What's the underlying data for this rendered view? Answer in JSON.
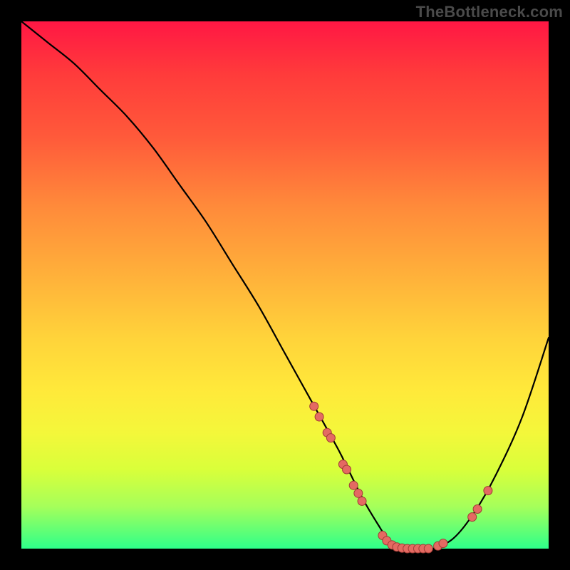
{
  "watermark": "TheBottleneck.com",
  "chart_data": {
    "type": "line",
    "title": "",
    "xlabel": "",
    "ylabel": "",
    "xlim": [
      0,
      100
    ],
    "ylim": [
      0,
      100
    ],
    "grid": false,
    "legend": false,
    "background_gradient": [
      "#ff1744",
      "#ff5a3a",
      "#ffb03a",
      "#ffe93a",
      "#d9ff3a",
      "#2eff8a"
    ],
    "series": [
      {
        "name": "bottleneck-curve",
        "color": "#000000",
        "x": [
          0,
          5,
          10,
          15,
          20,
          25,
          30,
          35,
          40,
          45,
          50,
          55,
          60,
          62,
          65,
          68,
          70,
          72,
          75,
          78,
          82,
          86,
          90,
          95,
          100
        ],
        "y": [
          100,
          96,
          92,
          87,
          82,
          76,
          69,
          62,
          54,
          46,
          37,
          28,
          19,
          15,
          9,
          4,
          1,
          0,
          0,
          0,
          2,
          7,
          14,
          25,
          40
        ]
      }
    ],
    "markers": [
      {
        "name": "cluster-left-upper",
        "x": 55.5,
        "y": 27
      },
      {
        "name": "cluster-left-upper",
        "x": 56.5,
        "y": 25
      },
      {
        "name": "cluster-left-upper",
        "x": 58.0,
        "y": 22
      },
      {
        "name": "cluster-left-upper",
        "x": 58.7,
        "y": 21
      },
      {
        "name": "cluster-left-mid",
        "x": 61.0,
        "y": 16
      },
      {
        "name": "cluster-left-mid",
        "x": 61.7,
        "y": 15
      },
      {
        "name": "cluster-left-mid",
        "x": 63.0,
        "y": 12
      },
      {
        "name": "cluster-left-mid",
        "x": 63.9,
        "y": 10.5
      },
      {
        "name": "cluster-left-mid",
        "x": 64.6,
        "y": 9
      },
      {
        "name": "cluster-bottom",
        "x": 68.5,
        "y": 2.5
      },
      {
        "name": "cluster-bottom",
        "x": 69.3,
        "y": 1.5
      },
      {
        "name": "cluster-bottom",
        "x": 70.3,
        "y": 0.7
      },
      {
        "name": "cluster-bottom",
        "x": 71.2,
        "y": 0.3
      },
      {
        "name": "cluster-bottom",
        "x": 72.2,
        "y": 0.1
      },
      {
        "name": "cluster-bottom",
        "x": 73.2,
        "y": 0
      },
      {
        "name": "cluster-bottom",
        "x": 74.2,
        "y": 0
      },
      {
        "name": "cluster-bottom",
        "x": 75.2,
        "y": 0
      },
      {
        "name": "cluster-bottom",
        "x": 76.2,
        "y": 0
      },
      {
        "name": "cluster-bottom",
        "x": 77.2,
        "y": 0
      },
      {
        "name": "cluster-bottom",
        "x": 79.0,
        "y": 0.5
      },
      {
        "name": "cluster-bottom",
        "x": 80.0,
        "y": 1
      },
      {
        "name": "cluster-right",
        "x": 85.5,
        "y": 6
      },
      {
        "name": "cluster-right",
        "x": 86.5,
        "y": 7.5
      },
      {
        "name": "cluster-right",
        "x": 88.5,
        "y": 11
      }
    ],
    "marker_color": "#e46a62"
  }
}
